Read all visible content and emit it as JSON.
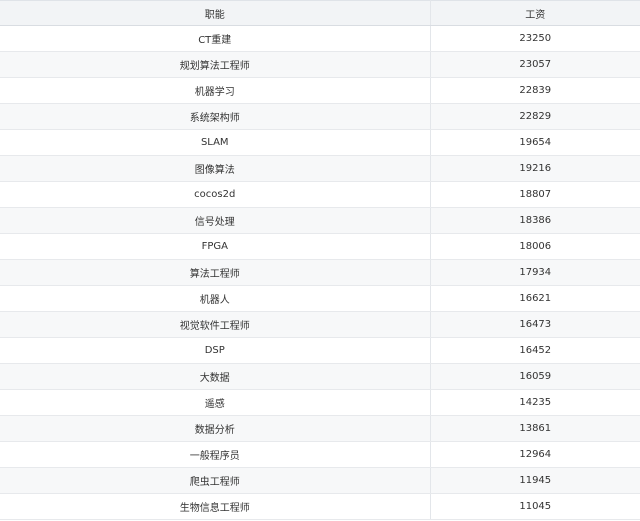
{
  "table": {
    "headers": [
      "职能",
      "工资"
    ],
    "rows": [
      {
        "role": "CT重建",
        "salary": "23250"
      },
      {
        "role": "规划算法工程师",
        "salary": "23057"
      },
      {
        "role": "机器学习",
        "salary": "22839"
      },
      {
        "role": "系统架构师",
        "salary": "22829"
      },
      {
        "role": "SLAM",
        "salary": "19654"
      },
      {
        "role": "图像算法",
        "salary": "19216"
      },
      {
        "role": "cocos2d",
        "salary": "18807"
      },
      {
        "role": "信号处理",
        "salary": "18386"
      },
      {
        "role": "FPGA",
        "salary": "18006"
      },
      {
        "role": "算法工程师",
        "salary": "17934"
      },
      {
        "role": "机器人",
        "salary": "16621"
      },
      {
        "role": "视觉软件工程师",
        "salary": "16473"
      },
      {
        "role": "DSP",
        "salary": "16452"
      },
      {
        "role": "大数据",
        "salary": "16059"
      },
      {
        "role": "遥感",
        "salary": "14235"
      },
      {
        "role": "数据分析",
        "salary": "13861"
      },
      {
        "role": "一般程序员",
        "salary": "12964"
      },
      {
        "role": "爬虫工程师",
        "salary": "11945"
      },
      {
        "role": "生物信息工程师",
        "salary": "11045"
      }
    ]
  }
}
